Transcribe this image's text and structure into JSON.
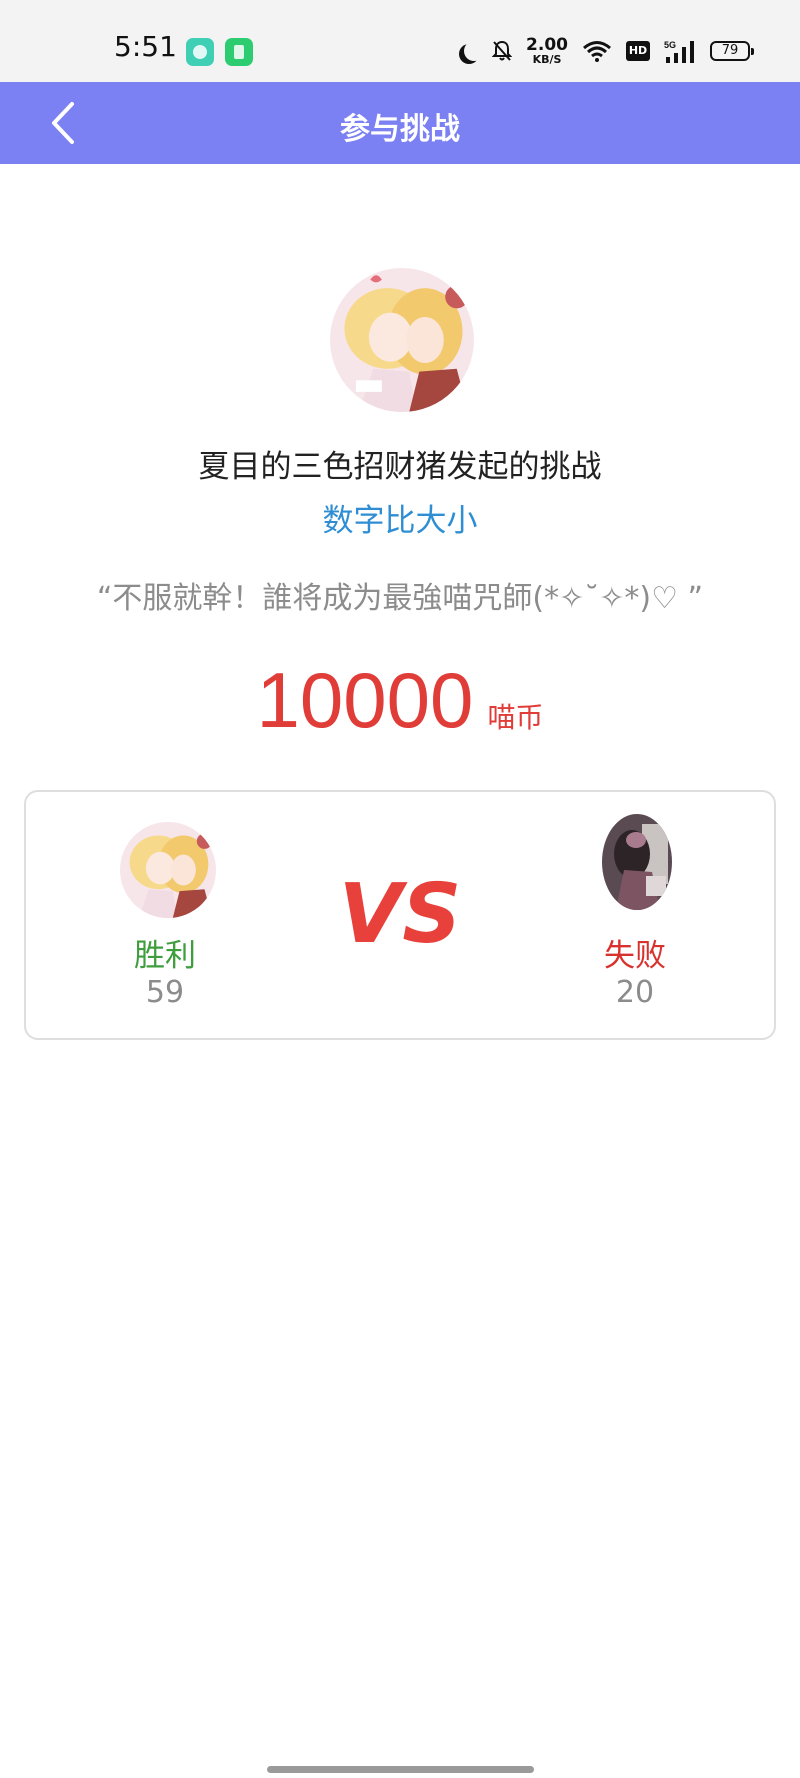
{
  "status_bar": {
    "time": "5:51",
    "net_speed_value": "2.00",
    "net_speed_unit": "KB/S",
    "hd_label": "HD",
    "network_label": "5G",
    "battery": "79"
  },
  "header": {
    "title": "参与挑战",
    "back_icon": "chevron-left-icon",
    "background_color": "#7b80f2"
  },
  "challenge": {
    "title": "夏目的三色招财猪发起的挑战",
    "game_name": "数字比大小",
    "quote": "“不服就幹！誰将成为最強喵咒師(*✧˘✧*)♡ ”",
    "stake_amount": "10000",
    "stake_unit": "喵币"
  },
  "record": {
    "vs_label": "VS",
    "win_label": "胜利",
    "win_count": "59",
    "lose_label": "失败",
    "lose_count": "20"
  },
  "colors": {
    "accent_purple": "#7b80f2",
    "stake_red": "#e03c38",
    "win_green": "#3e9e3e",
    "lose_red": "#d8322f",
    "link_blue": "#2f8ed3"
  }
}
